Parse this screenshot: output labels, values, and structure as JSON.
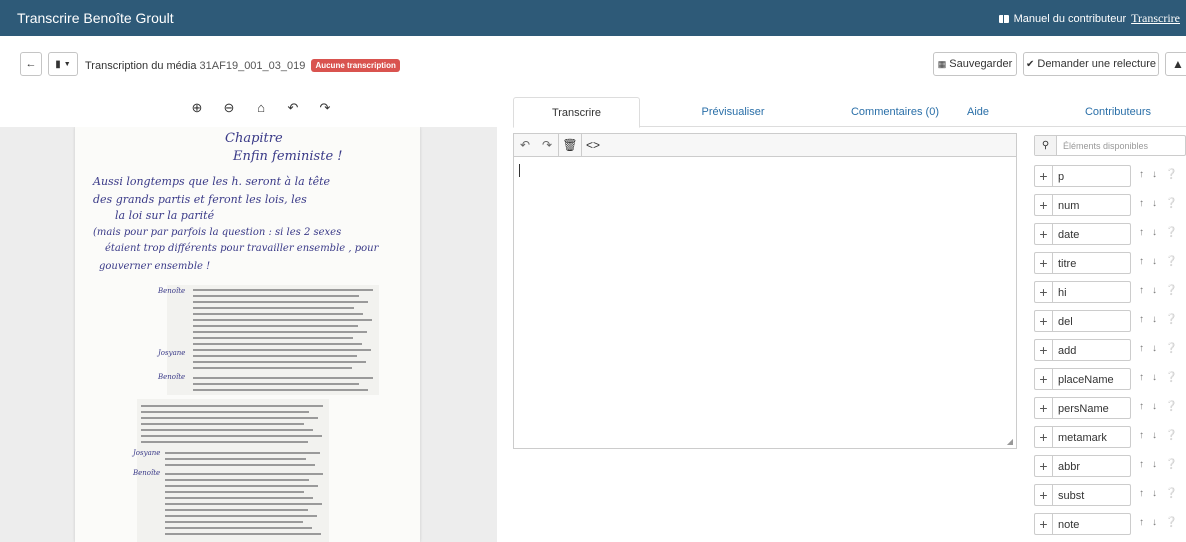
{
  "app": {
    "title": "Transcrire Benoîte Groult",
    "manual_link": "Manuel du contributeur",
    "transcribe_link": "Transcrire"
  },
  "toolbar": {
    "media_prefix": "Transcription du média",
    "media_id": "31AF19_001_03_019",
    "status_badge": "Aucune transcription",
    "save_label": "Sauvegarder",
    "review_label": "Demander une relecture"
  },
  "image_tools": [
    "zoom-in-icon",
    "zoom-out-icon",
    "home-icon",
    "rotate-left-icon",
    "rotate-right-icon"
  ],
  "tabs": [
    {
      "label": "Transcrire",
      "active": true
    },
    {
      "label": "Prévisualiser",
      "active": false
    },
    {
      "label": "Commentaires (0)",
      "active": false
    },
    {
      "label": "Aide",
      "active": false
    },
    {
      "label": "Contributeurs",
      "active": false
    }
  ],
  "editor": {
    "content": ""
  },
  "elements_panel": {
    "search_placeholder": "Éléments disponibles",
    "items": [
      "p",
      "num",
      "date",
      "titre",
      "hi",
      "del",
      "add",
      "placeName",
      "persName",
      "metamark",
      "abbr",
      "subst",
      "note"
    ]
  },
  "scan": {
    "handwriting": [
      "Chapitre",
      "Enfin feministe !",
      "Aussi longtemps que les h. seront à la tête",
      "des grands partis et feront les lois, les",
      "la loi sur la parité",
      "(mais pour par parfois la question : si les 2 sexes",
      "étaient trop différents pour travailler ensemble , pour",
      "gouverner ensemble !"
    ],
    "margin_notes": [
      "Benoîte",
      "Josyane",
      "Benoîte",
      "Josyane",
      "Benoîte"
    ]
  }
}
